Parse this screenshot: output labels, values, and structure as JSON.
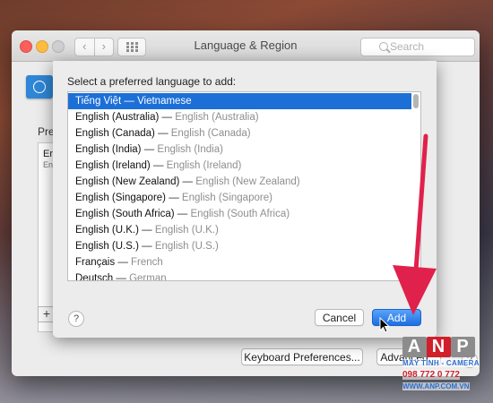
{
  "window": {
    "title": "Language & Region",
    "search_placeholder": "Search",
    "nav_back": "‹",
    "nav_forward": "›",
    "preferred_heading_partial": "Pre",
    "list_entry_partial": "En",
    "list_entry_sub_partial": "En",
    "add_symbol": "+",
    "keyboard_button": "Keyboard Preferences...",
    "advanced_button": "Advanced...",
    "help_symbol": "?"
  },
  "sheet": {
    "prompt": "Select a preferred language to add:",
    "languages": [
      {
        "name": "Tiếng Việt",
        "sep": "—",
        "english": "Vietnamese",
        "selected": true
      },
      {
        "name": "English (Australia)",
        "sep": "—",
        "english": "English (Australia)",
        "selected": false
      },
      {
        "name": "English (Canada)",
        "sep": "—",
        "english": "English (Canada)",
        "selected": false
      },
      {
        "name": "English (India)",
        "sep": "—",
        "english": "English (India)",
        "selected": false
      },
      {
        "name": "English (Ireland)",
        "sep": "—",
        "english": "English (Ireland)",
        "selected": false
      },
      {
        "name": "English (New Zealand)",
        "sep": "—",
        "english": "English (New Zealand)",
        "selected": false
      },
      {
        "name": "English (Singapore)",
        "sep": "—",
        "english": "English (Singapore)",
        "selected": false
      },
      {
        "name": "English (South Africa)",
        "sep": "—",
        "english": "English (South Africa)",
        "selected": false
      },
      {
        "name": "English (U.K.)",
        "sep": "—",
        "english": "English (U.K.)",
        "selected": false
      },
      {
        "name": "English (U.S.)",
        "sep": "—",
        "english": "English (U.S.)",
        "selected": false
      },
      {
        "name": "Français",
        "sep": "—",
        "english": "French",
        "selected": false
      },
      {
        "name": "Deutsch",
        "sep": "—",
        "english": "German",
        "selected": false
      }
    ],
    "help_symbol": "?",
    "cancel_button": "Cancel",
    "add_button": "Add"
  },
  "watermark": {
    "logo_letters": [
      "A",
      "N",
      "P"
    ],
    "line1": "MÁY TÍNH - CAMERA",
    "line2": "098 772 0 772",
    "line3": "WWW.ANP.COM.VN"
  },
  "colors": {
    "selection": "#1d6fd8",
    "arrow": "#e0214b",
    "primary_button": "#1c6ee2"
  }
}
